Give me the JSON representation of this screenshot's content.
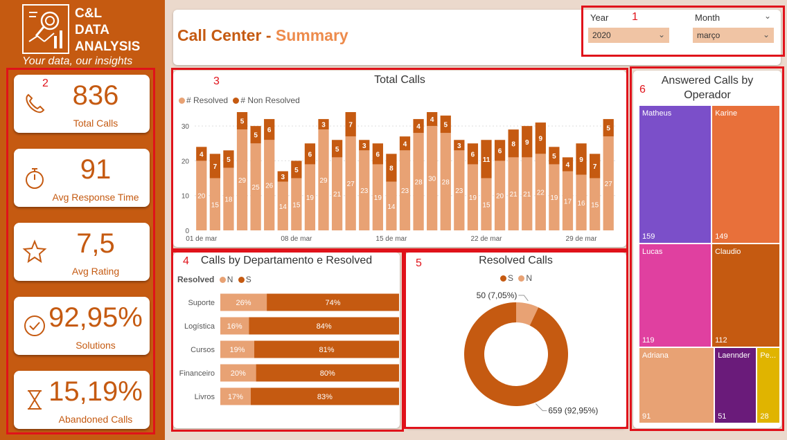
{
  "brand": {
    "line1": "C&L",
    "line2": "DATA",
    "line3": "ANALYSIS",
    "tagline": "Your data, our insights"
  },
  "header": {
    "title_main": "Call Center -",
    "title_accent": "Summary"
  },
  "filters": {
    "year_label": "Year",
    "year_value": "2020",
    "month_label": "Month",
    "month_value": "março"
  },
  "markers": [
    "1",
    "2",
    "3",
    "4",
    "5",
    "6"
  ],
  "kpis": [
    {
      "value": "836",
      "label": "Total Calls",
      "icon": "phone-icon"
    },
    {
      "value": "91",
      "label": "Avg Response Time",
      "icon": "stopwatch-icon"
    },
    {
      "value": "7,5",
      "label": "Avg Rating",
      "icon": "star-icon"
    },
    {
      "value": "92,95%",
      "label": "Solutions",
      "icon": "check-circle-icon"
    },
    {
      "value": "15,19%",
      "label": "Abandoned Calls",
      "icon": "hourglass-icon"
    }
  ],
  "colors": {
    "dark": "#c55a11",
    "light": "#e8a274",
    "accent": "#ed8b4c",
    "highlight": "#e0121a"
  },
  "chart_data": [
    {
      "type": "bar",
      "stacked": true,
      "title": "Total Calls",
      "categories": [
        "01 de mar",
        "02",
        "03",
        "04",
        "05",
        "06",
        "07",
        "08 de mar",
        "09",
        "10",
        "11",
        "12",
        "13",
        "14",
        "15 de mar",
        "16",
        "17",
        "18",
        "19",
        "20",
        "21",
        "22 de mar",
        "23",
        "24",
        "25",
        "26",
        "27",
        "28",
        "29 de mar",
        "30",
        "31"
      ],
      "x_tick_labels": [
        "01 de mar",
        "08 de mar",
        "15 de mar",
        "22 de mar",
        "29 de mar"
      ],
      "series": [
        {
          "name": "# Resolved",
          "color": "#e8a274",
          "values": [
            20,
            15,
            18,
            29,
            25,
            26,
            14,
            15,
            19,
            29,
            21,
            27,
            23,
            19,
            14,
            23,
            28,
            30,
            28,
            23,
            19,
            15,
            20,
            21,
            21,
            22,
            19,
            17,
            16,
            15,
            27
          ]
        },
        {
          "name": "# Non Resolved",
          "color": "#c55a11",
          "values": [
            4,
            7,
            5,
            5,
            5,
            6,
            3,
            5,
            6,
            3,
            5,
            7,
            3,
            6,
            8,
            4,
            4,
            4,
            5,
            3,
            6,
            11,
            6,
            8,
            9,
            9,
            5,
            4,
            9,
            7,
            5
          ]
        }
      ],
      "ylim": [
        0,
        35
      ],
      "y_ticks": [
        0,
        10,
        20,
        30
      ],
      "grid": false,
      "legend": "top-left"
    },
    {
      "type": "bar",
      "orientation": "horizontal",
      "stacked": "100%",
      "title": "Calls by Departamento e Resolved",
      "legend_title": "Resolved",
      "categories": [
        "Suporte",
        "Logística",
        "Cursos",
        "Financeiro",
        "Livros"
      ],
      "series": [
        {
          "name": "N",
          "color": "#e8a274",
          "values": [
            26,
            16,
            19,
            20,
            17
          ]
        },
        {
          "name": "S",
          "color": "#c55a11",
          "values": [
            74,
            84,
            81,
            80,
            83
          ]
        }
      ],
      "legend": "top-left"
    },
    {
      "type": "pie",
      "donut": true,
      "title": "Resolved Calls",
      "slices": [
        {
          "name": "S",
          "value": 659,
          "label": "659 (92,95%)",
          "color": "#c55a11"
        },
        {
          "name": "N",
          "value": 50,
          "label": "50 (7,05%)",
          "color": "#e8a274"
        }
      ],
      "legend": "top-center"
    },
    {
      "type": "treemap",
      "title": "Answered Calls by Operador",
      "items": [
        {
          "name": "Matheus",
          "value": 159,
          "color": "#7b4fc9"
        },
        {
          "name": "Karine",
          "value": 149,
          "color": "#e8703a"
        },
        {
          "name": "Lucas",
          "value": 119,
          "color": "#e040a0"
        },
        {
          "name": "Claudio",
          "value": 112,
          "color": "#c55a11"
        },
        {
          "name": "Adriana",
          "value": 91,
          "color": "#e8a274"
        },
        {
          "name": "Laennder",
          "value": 51,
          "color": "#6a1b7a"
        },
        {
          "name": "Pe...",
          "value": 28,
          "color": "#e0b400"
        }
      ]
    }
  ]
}
